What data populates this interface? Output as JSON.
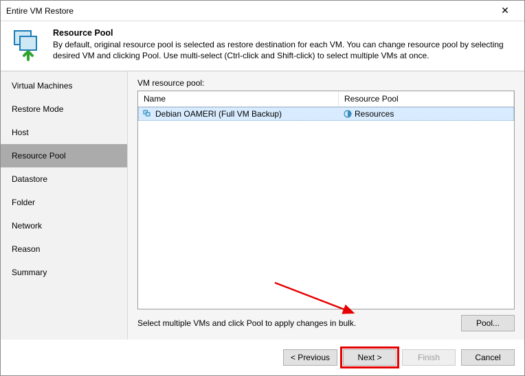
{
  "window": {
    "title": "Entire VM Restore"
  },
  "header": {
    "title": "Resource Pool",
    "description": "By default, original resource pool is selected as restore destination for each VM. You can change resource pool by selecting desired VM and clicking Pool. Use multi-select (Ctrl-click and Shift-click) to select multiple VMs at once."
  },
  "sidebar": {
    "items": [
      {
        "label": "Virtual Machines"
      },
      {
        "label": "Restore Mode"
      },
      {
        "label": "Host"
      },
      {
        "label": "Resource Pool"
      },
      {
        "label": "Datastore"
      },
      {
        "label": "Folder"
      },
      {
        "label": "Network"
      },
      {
        "label": "Reason"
      },
      {
        "label": "Summary"
      }
    ],
    "selected_index": 3
  },
  "main": {
    "list_label": "VM resource pool:",
    "columns": {
      "name": "Name",
      "resource_pool": "Resource Pool"
    },
    "rows": [
      {
        "name": "Debian OAMERI (Full VM Backup)",
        "resource_pool": "Resources"
      }
    ],
    "hint": "Select multiple VMs and click Pool to apply changes in bulk.",
    "pool_button": "Pool..."
  },
  "buttons": {
    "previous": "< Previous",
    "next": "Next >",
    "finish": "Finish",
    "cancel": "Cancel"
  }
}
